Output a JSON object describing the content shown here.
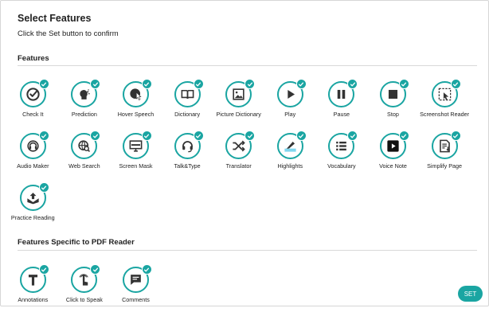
{
  "header": {
    "title": "Select Features",
    "subtitle": "Click the Set button to confirm"
  },
  "sections": [
    {
      "heading": "Features",
      "items": [
        {
          "label": "Check It",
          "icon": "check-it-icon",
          "selected": true
        },
        {
          "label": "Prediction",
          "icon": "prediction-icon",
          "selected": true
        },
        {
          "label": "Hover Speech",
          "icon": "hover-speech-icon",
          "selected": true
        },
        {
          "label": "Dictionary",
          "icon": "dictionary-icon",
          "selected": true
        },
        {
          "label": "Picture Dictionary",
          "icon": "picture-dictionary-icon",
          "selected": true
        },
        {
          "label": "Play",
          "icon": "play-icon",
          "selected": true
        },
        {
          "label": "Pause",
          "icon": "pause-icon",
          "selected": true
        },
        {
          "label": "Stop",
          "icon": "stop-icon",
          "selected": true
        },
        {
          "label": "Screenshot Reader",
          "icon": "screenshot-reader-icon",
          "selected": true
        },
        {
          "label": "Audio Maker",
          "icon": "audio-maker-icon",
          "selected": true
        },
        {
          "label": "Web Search",
          "icon": "web-search-icon",
          "selected": true
        },
        {
          "label": "Screen Mask",
          "icon": "screen-mask-icon",
          "selected": true
        },
        {
          "label": "Talk&Type",
          "icon": "talk-type-icon",
          "selected": true
        },
        {
          "label": "Translator",
          "icon": "translator-icon",
          "selected": true
        },
        {
          "label": "Highlights",
          "icon": "highlights-icon",
          "selected": true
        },
        {
          "label": "Vocabulary",
          "icon": "vocabulary-icon",
          "selected": true
        },
        {
          "label": "Voice Note",
          "icon": "voice-note-icon",
          "selected": true
        },
        {
          "label": "Simplify Page",
          "icon": "simplify-page-icon",
          "selected": true
        },
        {
          "label": "Practice Reading",
          "icon": "practice-reading-icon",
          "selected": true
        }
      ]
    },
    {
      "heading": "Features Specific to PDF Reader",
      "items": [
        {
          "label": "Annotations",
          "icon": "annotations-icon",
          "selected": true
        },
        {
          "label": "Click to Speak",
          "icon": "click-to-speak-icon",
          "selected": true
        },
        {
          "label": "Comments",
          "icon": "comments-icon",
          "selected": true
        }
      ]
    }
  ],
  "actions": {
    "set_label": "SET"
  },
  "colors": {
    "accent": "#1aa5a2",
    "icon": "#333333",
    "highlight": "#7fd6ee"
  }
}
